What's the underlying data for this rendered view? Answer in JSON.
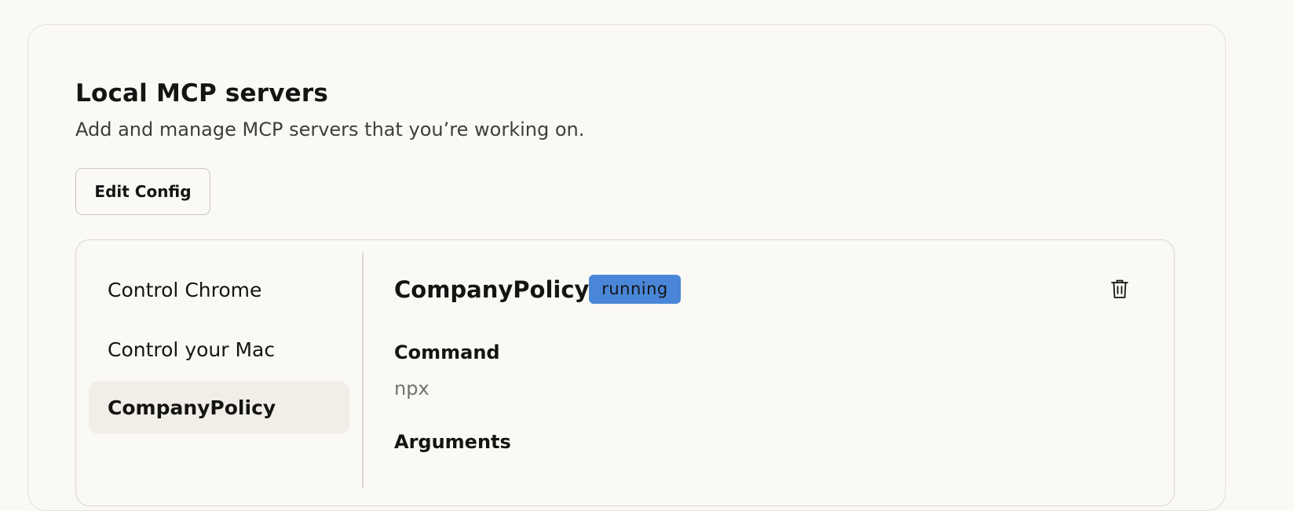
{
  "section": {
    "title": "Local MCP servers",
    "subtitle": "Add and manage MCP servers that you’re working on.",
    "edit_config_label": "Edit Config"
  },
  "sidebar": {
    "items": [
      {
        "label": "Control Chrome",
        "active": false
      },
      {
        "label": "Control your Mac",
        "active": false
      },
      {
        "label": "CompanyPolicy",
        "active": true
      }
    ]
  },
  "detail": {
    "server_name": "CompanyPolicy",
    "status": "running",
    "command_label": "Command",
    "command_value": "npx",
    "arguments_label": "Arguments"
  },
  "icons": {
    "delete": "trash-icon"
  },
  "colors": {
    "background": "#faf9f5",
    "status_running": "#4a86d8",
    "active_item_bg": "#f0eee6",
    "muted_text": "#73726c"
  }
}
